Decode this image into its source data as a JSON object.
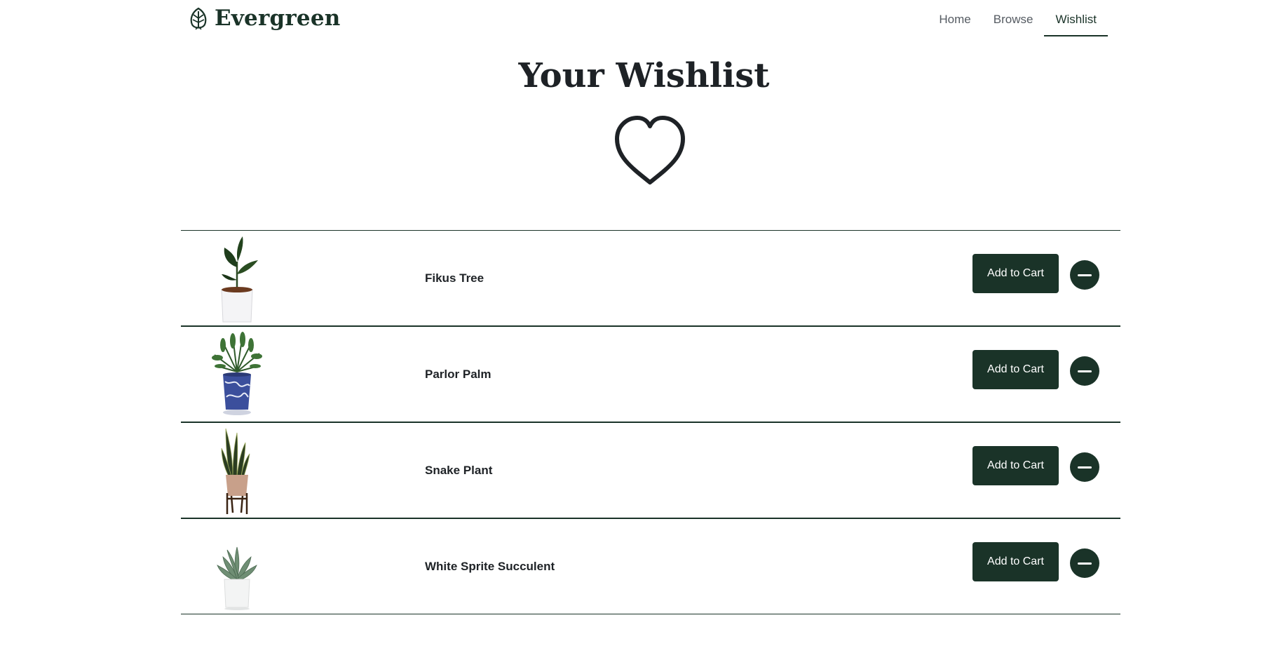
{
  "brand": {
    "name": "Evergreen",
    "logo_icon": "leaf-icon"
  },
  "nav": {
    "items": [
      {
        "label": "Home",
        "active": false
      },
      {
        "label": "Browse",
        "active": false
      },
      {
        "label": "Wishlist",
        "active": true
      }
    ]
  },
  "page": {
    "title": "Your Wishlist",
    "hero_icon": "heart-outline-icon"
  },
  "wishlist": {
    "items": [
      {
        "name": "Fikus Tree",
        "image": "fikus-tree-photo",
        "add_label": "Add to Cart",
        "remove_icon": "minus-icon"
      },
      {
        "name": "Parlor Palm",
        "image": "parlor-palm-photo",
        "add_label": "Add to Cart",
        "remove_icon": "minus-icon"
      },
      {
        "name": "Snake Plant",
        "image": "snake-plant-photo",
        "add_label": "Add to Cart",
        "remove_icon": "minus-icon"
      },
      {
        "name": "White Sprite Succulent",
        "image": "white-sprite-succulent-photo",
        "add_label": "Add to Cart",
        "remove_icon": "minus-icon"
      }
    ]
  },
  "colors": {
    "brand_dark": "#1a3328",
    "text": "#1e2226",
    "nav_text": "#555b62",
    "background": "#ffffff"
  }
}
